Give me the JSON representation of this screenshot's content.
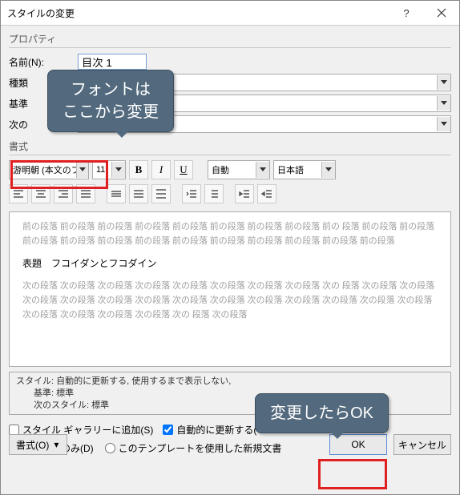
{
  "window": {
    "title": "スタイルの変更"
  },
  "section_properties": "プロパティ",
  "labels": {
    "name": "名前(N):",
    "type": "種類",
    "base": "基準",
    "next": "次の"
  },
  "name_value": "目次 1",
  "section_format": "書式",
  "toolbar": {
    "font": "游明朝 (本文のフ",
    "size": "11",
    "bold": "B",
    "italic": "I",
    "underline": "U",
    "color": "自動",
    "lang": "日本語"
  },
  "preview": {
    "before": "前の段落 前の段落 前の段落 前の段落 前の段落 前の段落 前の段落 前の段落 前の 段落 前の段落 前の段落 前の段落 前の段落 前の段落 前の段落 前の段落 前の段落 前の段落 前の段落 前の段落 前の段落",
    "sample": "表題　フコイダンとフコダイン",
    "after": "次の段落 次の段落 次の段落 次の段落 次の段落 次の段落 次の段落 次の段落 次の 段落 次の段落 次の段落 次の段落 次の段落 次の段落 次の段落 次の段落 次の段落 次の段落 次の段落 次の段落 次の段落 次の段落 次の段落 次の段落 次の段落 次の段落 次の 段落 次の段落"
  },
  "description": {
    "line1": "スタイル: 自動的に更新する, 使用するまで表示しない,",
    "line2": "　　基準: 標準",
    "line3": "　　次のスタイル: 標準"
  },
  "checks": {
    "gallery": "スタイル ギャラリーに追加(S)",
    "auto": "自動的に更新する("
  },
  "radios": {
    "doc": "この文書のみ(D)",
    "tmpl": "このテンプレートを使用した新規文書"
  },
  "footer": {
    "format": "書式(O)",
    "ok": "OK",
    "cancel": "キャンセル"
  },
  "callouts": {
    "top": "フォントは\nここから変更",
    "bottom": "変更したらOK"
  }
}
